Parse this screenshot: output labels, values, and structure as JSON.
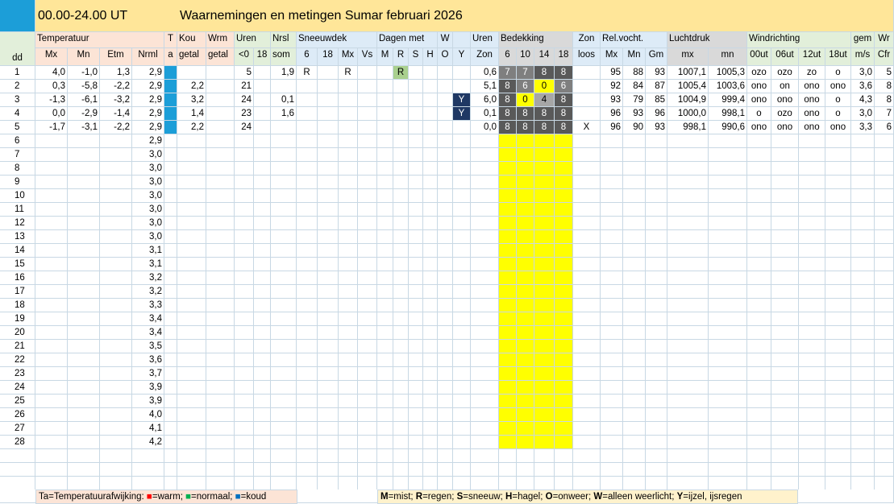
{
  "title": {
    "time_range": "00.00-24.00 UT",
    "heading": "Waarnemingen en metingen Sumar februari 2026"
  },
  "colors": {
    "blue_marker": "#1c9ed8",
    "header_orange": "#fce4d6",
    "header_green": "#e2efda",
    "header_blue": "#ddebf7",
    "header_grey": "#d9d9d9",
    "title_yellow": "#ffe699",
    "cover_dark": "#595959",
    "cover_mid": "#7f7f7f",
    "cover_light": "#a6a6a6",
    "cover_yellow": "#ffff00",
    "ijzel_navy": "#1f3864",
    "mist_green": "#a9d08e",
    "legend_red": "#ff0000",
    "legend_green": "#00b050",
    "legend_blue": "#0070c0"
  },
  "headers": {
    "dd": "dd",
    "temperatuur": "Temperatuur",
    "mx": "Mx",
    "mn": "Mn",
    "etm": "Etm",
    "nrml": "Nrml",
    "t": "T",
    "a": "a",
    "kou": "Kou",
    "getal1": "getal",
    "wrm": "Wrm",
    "getal2": "getal",
    "uren": "Uren",
    "lt0": "<0",
    "u18": "18",
    "nrsl": "Nrsl",
    "som": "som",
    "sneeuwdek": "Sneeuwdek",
    "s6": "6",
    "s18": "18",
    "smx": "Mx",
    "svs": "Vs",
    "dagenmet": "Dagen met",
    "dm": "M",
    "dr": "R",
    "ds": "S",
    "dh": "H",
    "w": "W",
    "wo": "O",
    "y": "Y",
    "uren2": "Uren",
    "zon": "Zon",
    "bedekking": "Bedekking",
    "b6": "6",
    "b10": "10",
    "b14": "14",
    "b18": "18",
    "zon2": "Zon",
    "loos": "loos",
    "relvocht": "Rel.vocht.",
    "rmx": "Mx",
    "rmn": "Mn",
    "rgm": "Gm",
    "luchtdruk": "Luchtdruk",
    "lmx": "mx",
    "lmn": "mn",
    "windrichting": "Windrichting",
    "w00": "00ut",
    "w06": "06ut",
    "w12": "12ut",
    "w18": "18ut",
    "gem": "gem",
    "ms": "m/s",
    "wr": "Wr",
    "cfr": "Cfr"
  },
  "days": [
    {
      "dd": "1",
      "mx": "4,0",
      "mn": "-1,0",
      "etm": "1,3",
      "nrml": "2,9",
      "kou": "",
      "wrm": "",
      "lt0": "5",
      "u18": "",
      "nrsl": "1,9",
      "s6": "R",
      "s18": "",
      "smx": "R",
      "svs": "",
      "dm": "",
      "dr": "R",
      "ds": "",
      "dh": "",
      "wo": "",
      "wa": "",
      "y": "",
      "zon": "0,6",
      "b6": "7",
      "b10": "7",
      "b14": "8",
      "b18": "8",
      "loos": "",
      "rmx": "95",
      "rmn": "88",
      "rgm": "93",
      "lmx": "1007,1",
      "lmn": "1005,3",
      "w00": "ozo",
      "w06": "ozo",
      "w12": "zo",
      "w18": "o",
      "gem": "3,0",
      "cfr": "5"
    },
    {
      "dd": "2",
      "mx": "0,3",
      "mn": "-5,8",
      "etm": "-2,2",
      "nrml": "2,9",
      "kou": "2,2",
      "wrm": "",
      "lt0": "21",
      "u18": "",
      "nrsl": "",
      "s6": "",
      "s18": "",
      "smx": "",
      "svs": "",
      "dm": "",
      "dr": "",
      "ds": "",
      "dh": "",
      "wo": "",
      "wa": "",
      "y": "",
      "zon": "5,1",
      "b6": "8",
      "b10": "6",
      "b14": "0",
      "b18": "6",
      "loos": "",
      "rmx": "92",
      "rmn": "84",
      "rgm": "87",
      "lmx": "1005,4",
      "lmn": "1003,6",
      "w00": "ono",
      "w06": "on",
      "w12": "ono",
      "w18": "ono",
      "gem": "3,6",
      "cfr": "8"
    },
    {
      "dd": "3",
      "mx": "-1,3",
      "mn": "-6,1",
      "etm": "-3,2",
      "nrml": "2,9",
      "kou": "3,2",
      "wrm": "",
      "lt0": "24",
      "u18": "",
      "nrsl": "0,1",
      "s6": "",
      "s18": "",
      "smx": "",
      "svs": "",
      "dm": "",
      "dr": "",
      "ds": "",
      "dh": "",
      "wo": "",
      "wa": "",
      "y": "Y",
      "zon": "6,0",
      "b6": "8",
      "b10": "0",
      "b14": "4",
      "b18": "8",
      "loos": "",
      "rmx": "93",
      "rmn": "79",
      "rgm": "85",
      "lmx": "1004,9",
      "lmn": "999,4",
      "w00": "ono",
      "w06": "ono",
      "w12": "ono",
      "w18": "o",
      "gem": "4,3",
      "cfr": "8"
    },
    {
      "dd": "4",
      "mx": "0,0",
      "mn": "-2,9",
      "etm": "-1,4",
      "nrml": "2,9",
      "kou": "1,4",
      "wrm": "",
      "lt0": "23",
      "u18": "",
      "nrsl": "1,6",
      "s6": "",
      "s18": "",
      "smx": "",
      "svs": "",
      "dm": "",
      "dr": "",
      "ds": "",
      "dh": "",
      "wo": "",
      "wa": "",
      "y": "Y",
      "zon": "0,1",
      "b6": "8",
      "b10": "8",
      "b14": "8",
      "b18": "8",
      "loos": "",
      "rmx": "96",
      "rmn": "93",
      "rgm": "96",
      "lmx": "1000,0",
      "lmn": "998,1",
      "w00": "o",
      "w06": "ozo",
      "w12": "ono",
      "w18": "o",
      "gem": "3,0",
      "cfr": "7"
    },
    {
      "dd": "5",
      "mx": "-1,7",
      "mn": "-3,1",
      "etm": "-2,2",
      "nrml": "2,9",
      "kou": "2,2",
      "wrm": "",
      "lt0": "24",
      "u18": "",
      "nrsl": "",
      "s6": "",
      "s18": "",
      "smx": "",
      "svs": "",
      "dm": "",
      "dr": "",
      "ds": "",
      "dh": "",
      "wo": "",
      "wa": "",
      "y": "",
      "zon": "0,0",
      "b6": "8",
      "b10": "8",
      "b14": "8",
      "b18": "8",
      "loos": "X",
      "rmx": "96",
      "rmn": "90",
      "rgm": "93",
      "lmx": "998,1",
      "lmn": "990,6",
      "w00": "ono",
      "w06": "ono",
      "w12": "ono",
      "w18": "ono",
      "gem": "3,3",
      "cfr": "6"
    },
    {
      "dd": "6",
      "nrml": "2,9"
    },
    {
      "dd": "7",
      "nrml": "3,0"
    },
    {
      "dd": "8",
      "nrml": "3,0"
    },
    {
      "dd": "9",
      "nrml": "3,0"
    },
    {
      "dd": "10",
      "nrml": "3,0"
    },
    {
      "dd": "11",
      "nrml": "3,0"
    },
    {
      "dd": "12",
      "nrml": "3,0"
    },
    {
      "dd": "13",
      "nrml": "3,0"
    },
    {
      "dd": "14",
      "nrml": "3,1"
    },
    {
      "dd": "15",
      "nrml": "3,1"
    },
    {
      "dd": "16",
      "nrml": "3,2"
    },
    {
      "dd": "17",
      "nrml": "3,2"
    },
    {
      "dd": "18",
      "nrml": "3,3"
    },
    {
      "dd": "19",
      "nrml": "3,4"
    },
    {
      "dd": "20",
      "nrml": "3,4"
    },
    {
      "dd": "21",
      "nrml": "3,5"
    },
    {
      "dd": "22",
      "nrml": "3,6"
    },
    {
      "dd": "23",
      "nrml": "3,7"
    },
    {
      "dd": "24",
      "nrml": "3,9"
    },
    {
      "dd": "25",
      "nrml": "3,9"
    },
    {
      "dd": "26",
      "nrml": "4,0"
    },
    {
      "dd": "27",
      "nrml": "4,1"
    },
    {
      "dd": "28",
      "nrml": "4,2"
    }
  ],
  "legend": {
    "ta_label": "Ta=Temperatuurafwijking: ",
    "sq": "■",
    "warm": "=warm; ",
    "normaal": "=normaal; ",
    "koud": "=koud",
    "m": "M",
    "m_t": "=mist; ",
    "r": "R",
    "r_t": "=regen; ",
    "s": "S",
    "s_t": "=sneeuw; ",
    "h": "H",
    "h_t": "=hagel; ",
    "o": "O",
    "o_t": "=onweer; ",
    "w": "W",
    "w_t": "=alleen weerlicht; ",
    "y": "Y",
    "y_t": "=ijzel, ijsregen"
  }
}
